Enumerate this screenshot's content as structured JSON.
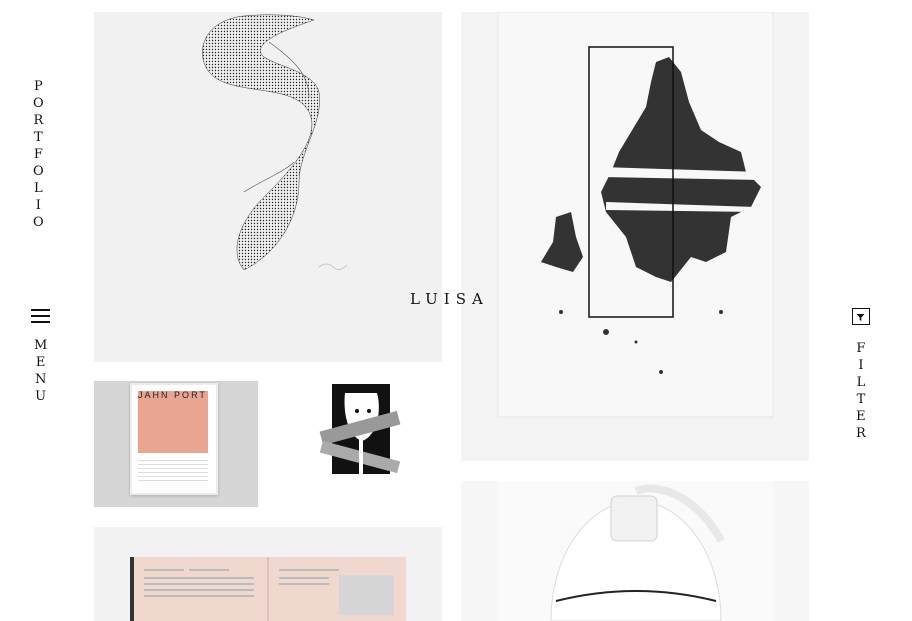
{
  "sidebar_left": {
    "portfolio_letters": [
      "P",
      "O",
      "R",
      "T",
      "F",
      "O",
      "L",
      "I",
      "O"
    ],
    "menu_letters": [
      "M",
      "E",
      "N",
      "U"
    ]
  },
  "sidebar_right": {
    "filter_letters": [
      "F",
      "I",
      "L",
      "T",
      "E",
      "R"
    ]
  },
  "logo": {
    "text": "LUISA"
  },
  "portfolio_items": [
    {
      "id": "tile-1",
      "subject": "wire sculpture drawing",
      "signature": "handwritten signature"
    },
    {
      "id": "tile-2",
      "subject": "black ink abstract map print"
    },
    {
      "id": "tile-3",
      "subject": "framed poster",
      "poster_text": [
        "J",
        "A",
        "H",
        "N",
        "P",
        "O",
        "R",
        "T"
      ]
    },
    {
      "id": "tile-4",
      "subject": "illustrated portrait"
    },
    {
      "id": "tile-5",
      "subject": "open book spread"
    },
    {
      "id": "tile-6",
      "subject": "white product object"
    }
  ],
  "colors": {
    "background": "#ffffff",
    "text": "#111111",
    "poster_accent": "#e9a592"
  }
}
